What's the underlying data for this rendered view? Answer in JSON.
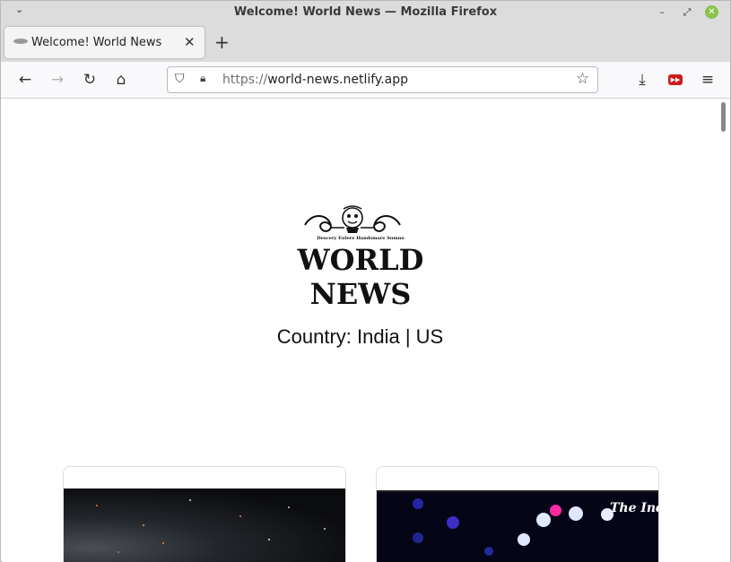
{
  "window": {
    "title": "Welcome! World News — Mozilla Firefox"
  },
  "tab": {
    "label": "Welcome! World News",
    "close": "✕",
    "new_tab": "+"
  },
  "navbar": {
    "url_protocol": "https://",
    "url_host": "world-news.netlify.app"
  },
  "page": {
    "logo_motto": "Descery Eulere Handsmare Sumno",
    "logo_wordmark": "WORLD NEWS",
    "country_line": "Country: India | US",
    "cards": [
      {
        "image_caption": ""
      },
      {
        "image_caption": "The Indi"
      }
    ]
  },
  "icons": {
    "back": "back-arrow-icon",
    "forward": "forward-arrow-icon",
    "reload": "reload-icon",
    "home": "home-icon",
    "shield": "shield-icon",
    "lock": "lock-icon",
    "star": "star-icon",
    "download": "download-icon",
    "youtube": "youtube-extension-icon",
    "menu": "hamburger-menu-icon"
  },
  "colors": {
    "titlebar": "#dcdcdc",
    "close_button": "#8bc34a",
    "youtube_red": "#cc1b1b"
  }
}
